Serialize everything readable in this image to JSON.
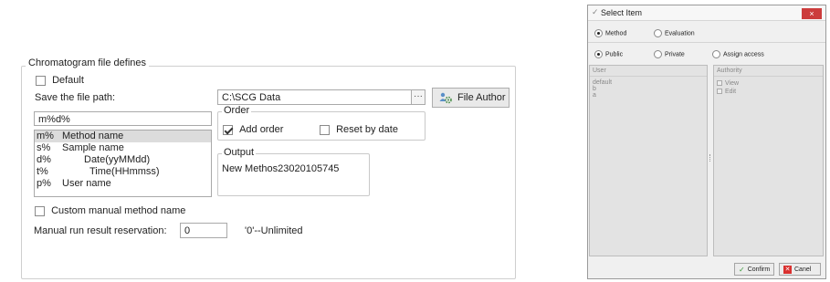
{
  "left": {
    "group_title": "Chromatogram file defines",
    "default_label": "Default",
    "default_checked": false,
    "save_path_label": "Save the file path:",
    "save_path_value": "C:\\SCG Data",
    "ellipsis_label": "···",
    "file_author_label": "File Author",
    "filename_pattern": "m%d%",
    "placeholders": [
      {
        "code": "m%",
        "desc": "Method name",
        "selected": true
      },
      {
        "code": "s%",
        "desc": "Sample name",
        "selected": false
      },
      {
        "code": "d%",
        "desc": "Date(yyMMdd)",
        "selected": false
      },
      {
        "code": "t%",
        "desc": "Time(HHmmss)",
        "selected": false
      },
      {
        "code": "p%",
        "desc": "User name",
        "selected": false
      }
    ],
    "order_title": "Order",
    "add_order_label": "Add order",
    "add_order_checked": true,
    "reset_by_date_label": "Reset by date",
    "reset_by_date_checked": false,
    "output_title": "Output",
    "output_value": "New Methos23020105745",
    "custom_manual_label": "Custom manual method name",
    "custom_manual_checked": false,
    "manual_run_label": "Manual run result reservation:",
    "manual_run_value": "0",
    "unlimited_hint": "'0'--Unlimited"
  },
  "dialog": {
    "title": "Select Item",
    "close_label": "×",
    "type_options": [
      {
        "label": "Method",
        "selected": true
      },
      {
        "label": "Evaluation",
        "selected": false
      }
    ],
    "access_options": [
      {
        "label": "Public",
        "selected": true
      },
      {
        "label": "Private",
        "selected": false
      },
      {
        "label": "Assign access",
        "selected": false
      }
    ],
    "user_header": "User",
    "users": [
      "default",
      "b",
      "a"
    ],
    "authority_header": "Authority",
    "authorities": [
      "View",
      "Edit"
    ],
    "confirm_label": "Confirm",
    "cancel_label": "Canel",
    "colors": {
      "close_red": "#cc3c3c",
      "cancel_red": "#d9302f",
      "confirm_green": "#3a9a3a"
    }
  }
}
